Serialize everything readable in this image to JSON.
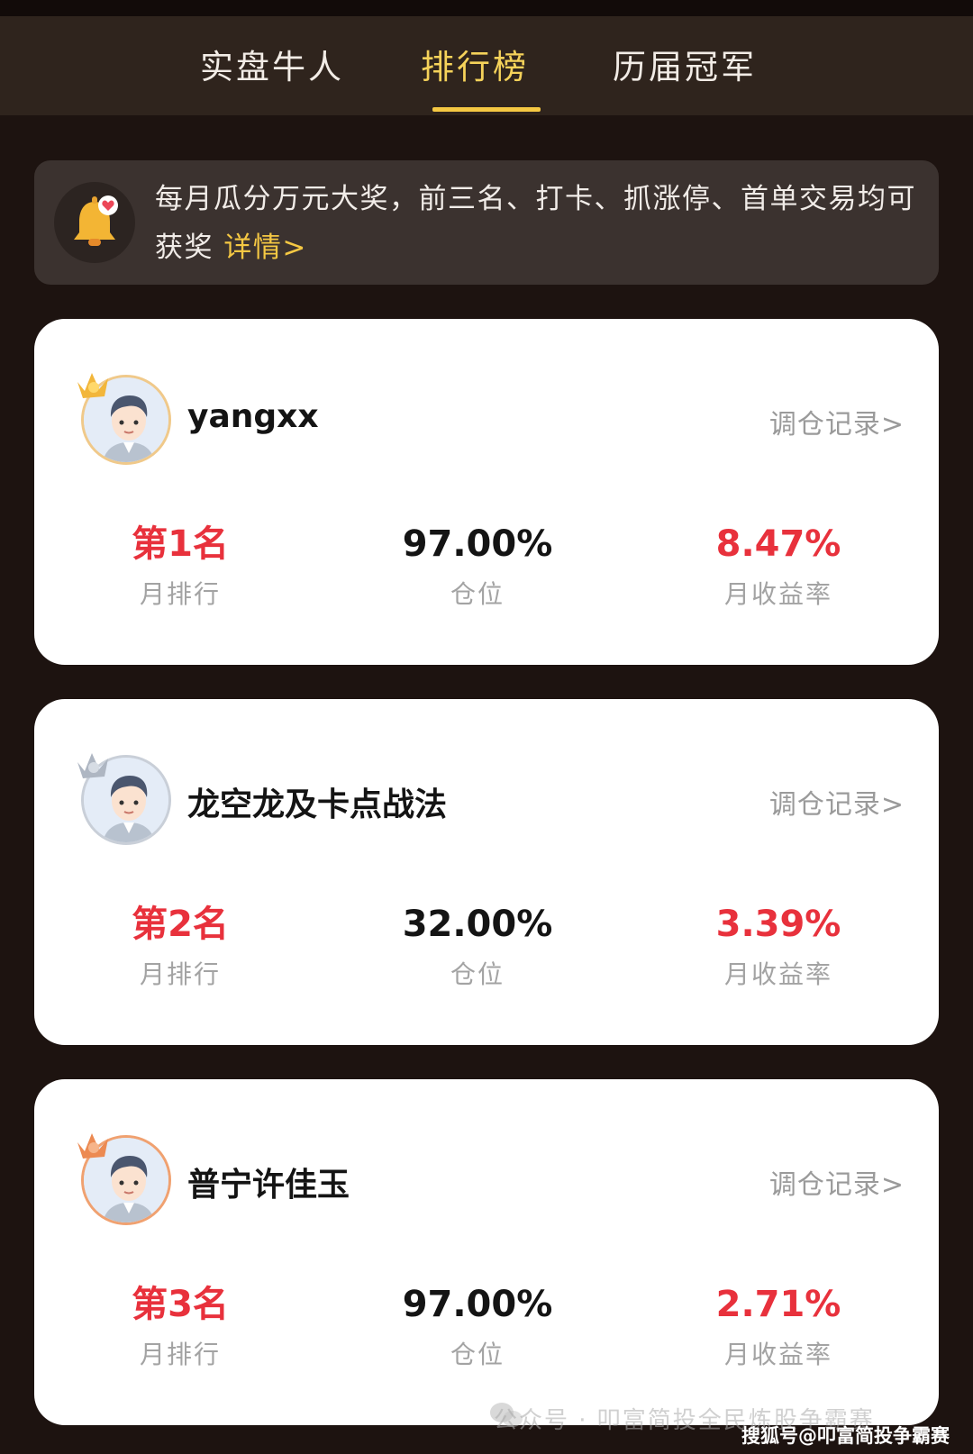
{
  "tabs": [
    {
      "label": "实盘牛人",
      "active": false
    },
    {
      "label": "排行榜",
      "active": true
    },
    {
      "label": "历届冠军",
      "active": false
    }
  ],
  "notice": {
    "text": "每月瓜分万元大奖，前三名、打卡、抓涨停、首单交易均可获奖",
    "link": "详情>"
  },
  "cards": [
    {
      "rank_medal": "gold",
      "username": "yangxx",
      "record_link": "调仓记录>",
      "rank_value": "第1名",
      "rank_label": "月排行",
      "position_value": "97.00%",
      "position_label": "仓位",
      "return_value": "8.47%",
      "return_label": "月收益率"
    },
    {
      "rank_medal": "silver",
      "username": "龙空龙及卡点战法",
      "record_link": "调仓记录>",
      "rank_value": "第2名",
      "rank_label": "月排行",
      "position_value": "32.00%",
      "position_label": "仓位",
      "return_value": "3.39%",
      "return_label": "月收益率"
    },
    {
      "rank_medal": "bronze",
      "username": "普宁许佳玉",
      "record_link": "调仓记录>",
      "rank_value": "第3名",
      "rank_label": "月排行",
      "position_value": "97.00%",
      "position_label": "仓位",
      "return_value": "2.71%",
      "return_label": "月收益率"
    }
  ],
  "watermark": "公众号 · 叩富简投全民炼股争霸赛",
  "source_tag": "搜狐号@叩富简投争霸赛",
  "colors": {
    "accent": "#f5c843",
    "red": "#e8313c",
    "background": "#1d1310",
    "tabbar": "#2f241d"
  }
}
